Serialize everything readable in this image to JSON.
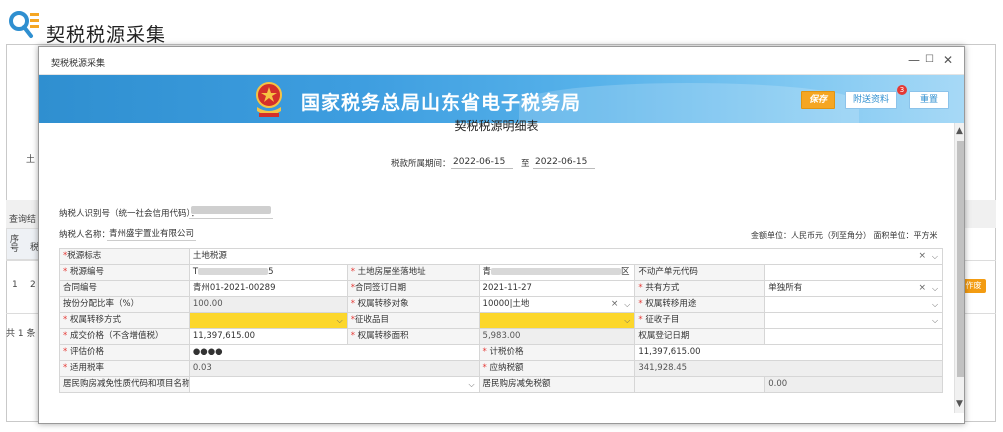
{
  "page": {
    "title": "契税税源采集",
    "fragments": {
      "land_label": "土",
      "query_label": "查询结",
      "col_seq": "序号",
      "col_tax": "税",
      "row_index": "1",
      "row_code": "2",
      "total": "共 1 条",
      "op_button": "作废"
    }
  },
  "modal": {
    "title": "契税税源采集",
    "controls": {
      "minimize": "—",
      "maximize": "☐",
      "close": "✕"
    },
    "banner_title": "国家税务总局山东省电子税务局",
    "buttons": {
      "save": "保存",
      "attach": "附送资料",
      "attach_badge": "3",
      "reset": "重置"
    },
    "doc_title": "契税税源明细表",
    "period": {
      "label": "税款所属期间：",
      "start": "2022-06-15",
      "to": "至",
      "end": "2022-06-15"
    },
    "taxpayer": {
      "id_label": "纳税人识别号（统一社会信用代码）：",
      "name_label": "纳税人名称：",
      "name_value": "青州盛宇置业有限公司"
    },
    "units": "金额单位：人民币元（列至角分）   面积单位：平方米",
    "form": {
      "r1": {
        "label": "税源标志",
        "value": "土地税源"
      },
      "r2": {
        "l1": "税源编号",
        "v1_prefix": "T",
        "v1_suffix": "5",
        "l2": "土地房屋坐落地址",
        "v2_prefix": "青",
        "v2_suffix": "区",
        "l3": "不动产单元代码",
        "v3": ""
      },
      "r3": {
        "l1": "合同编号",
        "v1": "青州01-2021-00289",
        "l2": "合同签订日期",
        "v2": "2021-11-27",
        "l3": "共有方式",
        "v3": "单独所有"
      },
      "r4": {
        "l1": "按份分配比率（%）",
        "v1": "100.00",
        "l2": "权属转移对象",
        "v2": "10000|土地",
        "l3": "权属转移用途",
        "v3": ""
      },
      "r5": {
        "l1": "权属转移方式",
        "v1": "",
        "l2": "征收品目",
        "v2": "",
        "l3": "征收子目",
        "v3": ""
      },
      "r6": {
        "l1": "成交价格（不含增值税）",
        "v1": "11,397,615.00",
        "l2": "权属转移面积",
        "v2": "5,983.00",
        "l3": "权属登记日期",
        "v3": ""
      },
      "r7": {
        "l1": "评估价格",
        "v1": "●●●●",
        "l2": "计税价格",
        "v2": "11,397,615.00"
      },
      "r8": {
        "l1": "适用税率",
        "v1": "0.03",
        "l2": "应纳税额",
        "v2": "341,928.45"
      },
      "r9": {
        "l1": "居民购房减免性质代码和项目名称",
        "v1": "",
        "l2": "居民购房减免税额",
        "v2": "0.00"
      }
    }
  },
  "colors": {
    "accent": "#2f8fd0",
    "save": "#f5a623",
    "highlight": "#fcd72b",
    "required": "#e53935"
  }
}
